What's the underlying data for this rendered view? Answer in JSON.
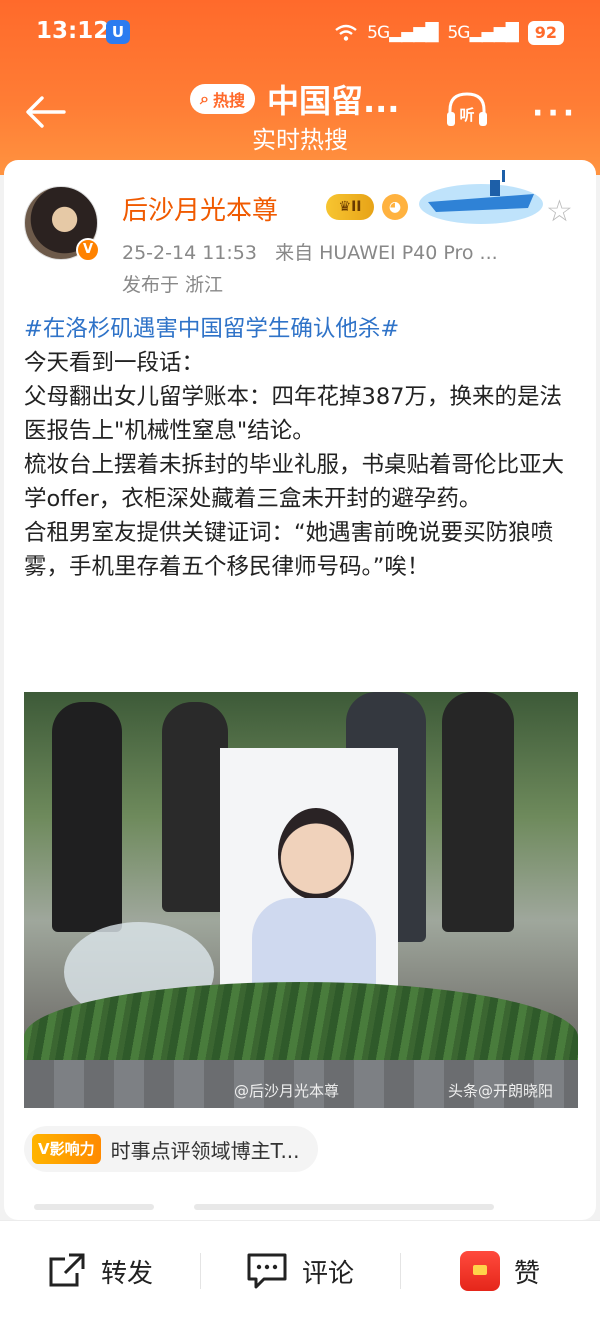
{
  "status_bar": {
    "time": "13:12",
    "app_badge": "U",
    "net1": "5G",
    "net2": "5G",
    "battery": "92"
  },
  "nav": {
    "hot_badge": "热搜",
    "title": "中国留...",
    "subtitle": "实时热搜",
    "listen_label": "听"
  },
  "post": {
    "username": "后沙月光本尊",
    "level_badge": "II",
    "timestamp": "25-2-14 11:53",
    "source": "来自 HUAWEI P40 Pro ...",
    "location": "发布于 浙江",
    "hashtag": "#在洛杉矶遇害中国留学生确认他杀#",
    "paragraphs": [
      "今天看到一段话：",
      "父母翻出女儿留学账本：四年花掉387万，换来的是法医报告上\"机械性窒息\"结论。",
      "梳妆台上摆着未拆封的毕业礼服，书桌贴着哥伦比亚大学offer，衣柜深处藏着三盒未开封的避孕药。",
      "合租男室友提供关键证词：“她遇害前晚说要买防狼喷雾，手机里存着五个移民律师号码。”唉！"
    ],
    "image_watermark_left": "@后沙月光本尊",
    "image_watermark_right": "头条@开朗晓阳"
  },
  "influence": {
    "badge": "V影响力",
    "text": "时事点评领域博主T..."
  },
  "actions": {
    "repost": "转发",
    "comment": "评论",
    "like": "赞"
  },
  "colors": {
    "header_orange": "#ff6a2b",
    "username_orange": "#f05a00",
    "hashtag_blue": "#2f73c8",
    "like_red": "#e5261a"
  }
}
